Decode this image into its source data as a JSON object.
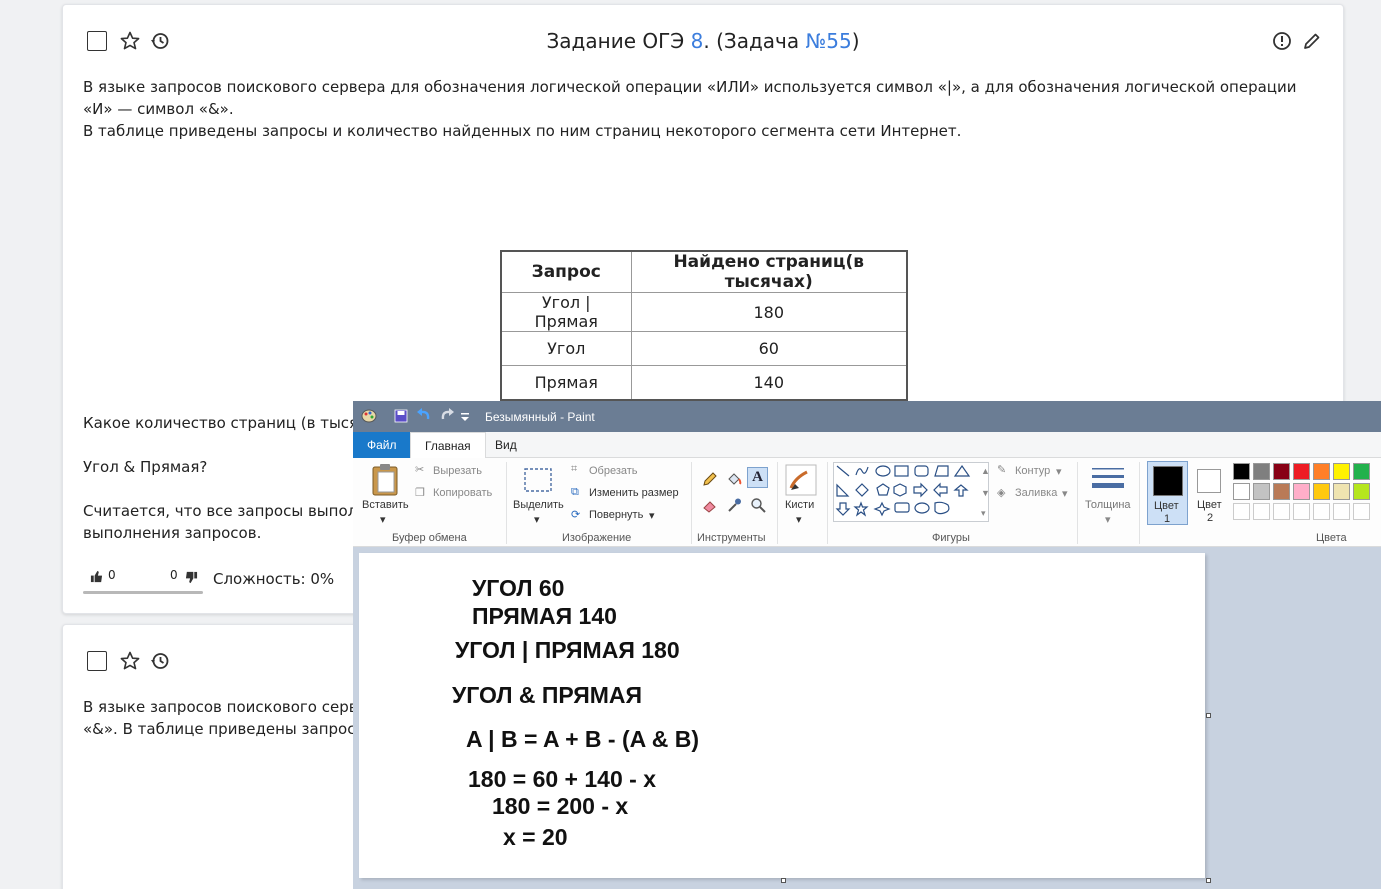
{
  "card1": {
    "title_prefix": "Задание ОГЭ ",
    "title_task_num": "8",
    "title_middle": ". (Задача ",
    "title_problem_num": "№55",
    "title_suffix": ")",
    "para1_line1": "В языке запросов поискового сервера для обозначения логической операции «ИЛИ» используется символ «|», а для обозначения логической операции",
    "para1_line2": "«И»  — символ «&».",
    "para1_line3": "В таблице приведены запросы и количество найденных по ним страниц некоторого сегмента сети Интернет.",
    "table": {
      "headers": [
        "Запрос",
        "Найдено страниц(в тысячах)"
      ],
      "rows": [
        [
          "Угол | Прямая",
          "180"
        ],
        [
          "Угол",
          "60"
        ],
        [
          "Прямая",
          "140"
        ]
      ]
    },
    "question_line": "Какое количество страниц (в тысяч",
    "query_line": "Угол & Прямая?",
    "note_line1": "Считается, что все запросы выпол",
    "note_line2": "выполнения запросов.",
    "likes": "0",
    "dislikes": "0",
    "difficulty": "Сложность: 0%"
  },
  "card2": {
    "para_line1": "В языке запросов поискового серв",
    "para_line2": "«&». В таблице приведены запрос"
  },
  "paint": {
    "window_title": "Безымянный - Paint",
    "tabs": {
      "file": "Файл",
      "home": "Главная",
      "view": "Вид"
    },
    "clipboard": {
      "paste": "Вставить",
      "cut": "Вырезать",
      "copy": "Копировать",
      "label": "Буфер обмена"
    },
    "image": {
      "select": "Выделить",
      "crop": "Обрезать",
      "resize": "Изменить размер",
      "rotate": "Повернуть",
      "label": "Изображение"
    },
    "tools_label": "Инструменты",
    "brushes": "Кисти",
    "shapes": {
      "outline": "Контур",
      "fill": "Заливка",
      "label": "Фигуры"
    },
    "thickness": "Толщина",
    "color1": {
      "label": "Цвет",
      "num": "1"
    },
    "color2": {
      "label": "Цвет",
      "num": "2"
    },
    "colors_label": "Цвета",
    "palette": [
      "#000000",
      "#7f7f7f",
      "#880015",
      "#ed1c24",
      "#ff7f27",
      "#fff200",
      "#22b14c",
      "#ffffff",
      "#c3c3c3",
      "#b97a57",
      "#ffaec9",
      "#ffc90e",
      "#efe4b0",
      "#b5e61d"
    ],
    "canvas_lines": [
      "УГОЛ 60",
      "ПРЯМАЯ 140",
      "УГОЛ | ПРЯМАЯ 180",
      "УГОЛ & ПРЯМАЯ",
      "A | B = A + B - (A & B)",
      "180 = 60 + 140 - x",
      "180 = 200 - x",
      "x = 20"
    ]
  }
}
